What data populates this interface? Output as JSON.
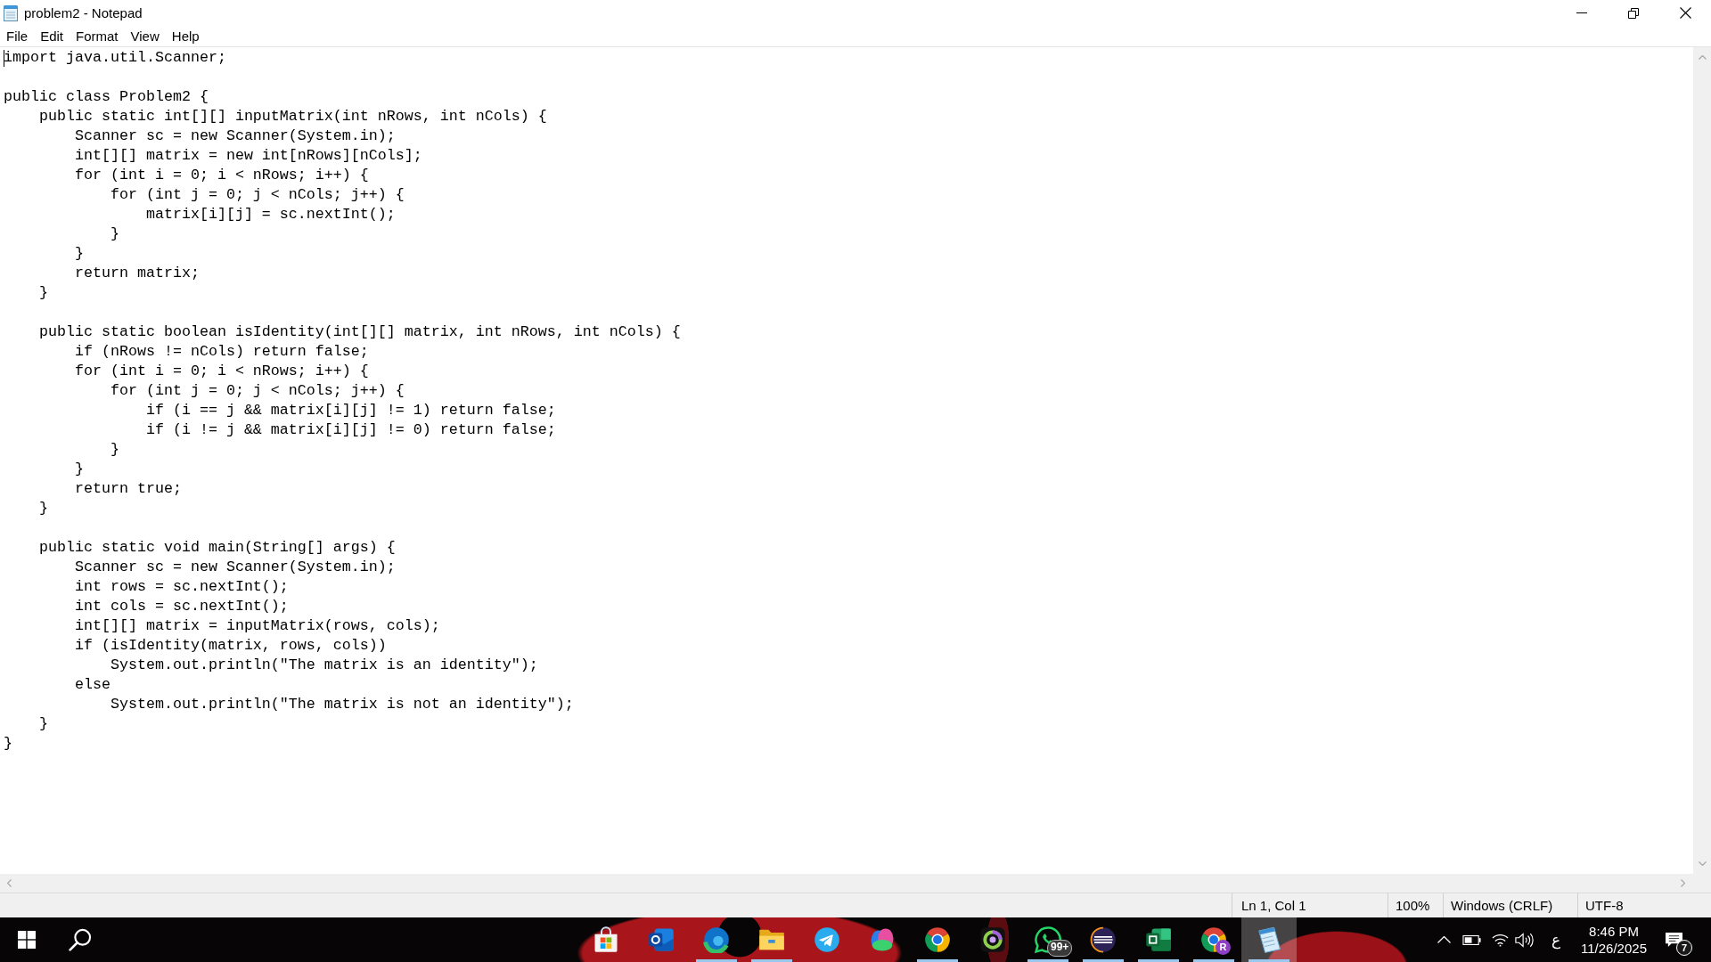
{
  "window": {
    "title": "problem2 - Notepad"
  },
  "menu": [
    "File",
    "Edit",
    "Format",
    "View",
    "Help"
  ],
  "editor": {
    "focused": true,
    "text": "import java.util.Scanner;\n\npublic class Problem2 {\n    public static int[][] inputMatrix(int nRows, int nCols) {\n        Scanner sc = new Scanner(System.in);\n        int[][] matrix = new int[nRows][nCols];\n        for (int i = 0; i < nRows; i++) {\n            for (int j = 0; j < nCols; j++) {\n                matrix[i][j] = sc.nextInt();\n            }\n        }\n        return matrix;\n    }\n\n    public static boolean isIdentity(int[][] matrix, int nRows, int nCols) {\n        if (nRows != nCols) return false;\n        for (int i = 0; i < nRows; i++) {\n            for (int j = 0; j < nCols; j++) {\n                if (i == j && matrix[i][j] != 1) return false;\n                if (i != j && matrix[i][j] != 0) return false;\n            }\n        }\n        return true;\n    }\n\n    public static void main(String[] args) {\n        Scanner sc = new Scanner(System.in);\n        int rows = sc.nextInt();\n        int cols = sc.nextInt();\n        int[][] matrix = inputMatrix(rows, cols);\n        if (isIdentity(matrix, rows, cols))\n            System.out.println(\"The matrix is an identity\");\n        else\n            System.out.println(\"The matrix is not an identity\");\n    }\n}"
  },
  "status_bar": {
    "position": "Ln 1, Col 1",
    "zoom": "100%",
    "line_ending": "Windows (CRLF)",
    "encoding": "UTF-8"
  },
  "taskbar": {
    "apps": [
      {
        "kind": "store",
        "running": false,
        "active": false
      },
      {
        "kind": "mail",
        "running": false,
        "active": false
      },
      {
        "kind": "edge",
        "running": true,
        "active": false
      },
      {
        "kind": "folder",
        "running": true,
        "active": false
      },
      {
        "kind": "telegram",
        "running": false,
        "active": false
      },
      {
        "kind": "blob",
        "running": false,
        "active": false
      },
      {
        "kind": "chrome",
        "running": true,
        "active": false
      },
      {
        "kind": "ring",
        "running": false,
        "active": false
      },
      {
        "kind": "whatsapp",
        "running": true,
        "active": false,
        "badge": "99+"
      },
      {
        "kind": "eclipse",
        "running": true,
        "active": false
      },
      {
        "kind": "excel",
        "running": true,
        "active": false
      },
      {
        "kind": "chrome",
        "running": true,
        "active": false,
        "profile": "R"
      },
      {
        "kind": "notepad",
        "running": true,
        "active": true
      }
    ],
    "tray": {
      "language": "ع",
      "time": "8:46 PM",
      "date": "11/26/2025",
      "notifications": "7"
    }
  }
}
